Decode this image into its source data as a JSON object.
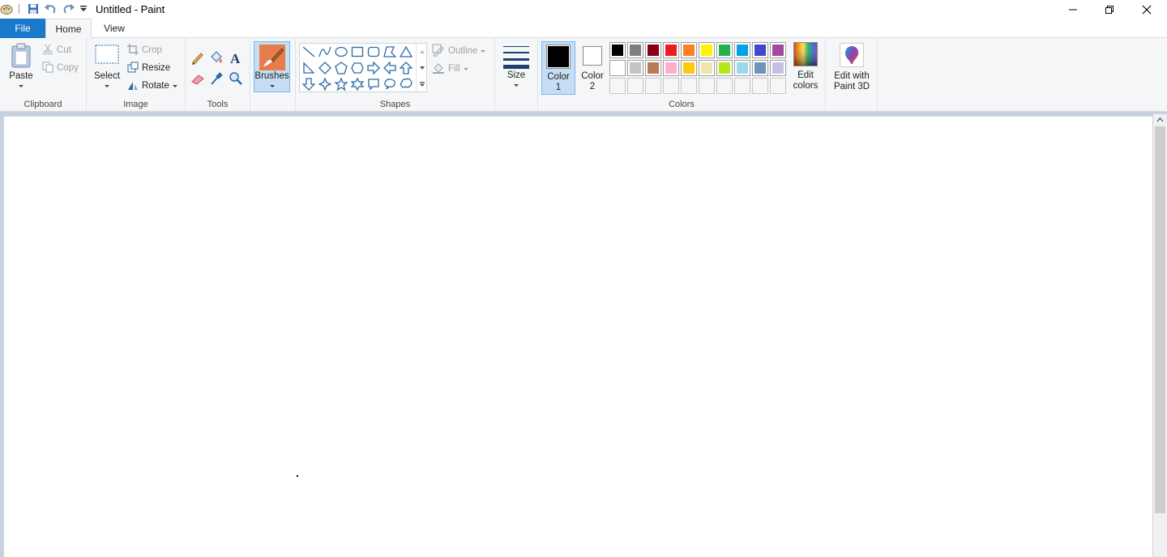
{
  "window": {
    "title": "Untitled - Paint"
  },
  "tabs": [
    {
      "label": "File"
    },
    {
      "label": "Home"
    },
    {
      "label": "View"
    }
  ],
  "help_glyph": "?",
  "clipboard": {
    "paste": "Paste",
    "cut": "Cut",
    "copy": "Copy",
    "group_label": "Clipboard"
  },
  "image": {
    "select": "Select",
    "crop": "Crop",
    "resize": "Resize",
    "rotate": "Rotate",
    "group_label": "Image"
  },
  "tools": {
    "group_label": "Tools"
  },
  "brushes": {
    "label": "Brushes"
  },
  "shapes": {
    "outline": "Outline",
    "fill": "Fill",
    "group_label": "Shapes"
  },
  "size": {
    "label": "Size"
  },
  "colors": {
    "color1_line1": "Color",
    "color1_line2": "1",
    "color2_line1": "Color",
    "color2_line2": "2",
    "edit_line1": "Edit",
    "edit_line2": "colors",
    "group_label": "Colors",
    "color1_value": "#000000",
    "color2_value": "#ffffff",
    "palette_row1": [
      "#000000",
      "#7f7f7f",
      "#880015",
      "#ed1c24",
      "#ff7f27",
      "#fff200",
      "#22b14c",
      "#00a2e8",
      "#3f48cc",
      "#a349a4"
    ],
    "palette_row2": [
      "#ffffff",
      "#c3c3c3",
      "#b97a57",
      "#ffaec9",
      "#ffc90e",
      "#efe4b0",
      "#b5e61d",
      "#99d9ea",
      "#7092be",
      "#c8bfe7"
    ]
  },
  "paint3d": {
    "line1": "Edit with",
    "line2": "Paint 3D"
  },
  "theme": {
    "accent": "#1979ca",
    "ribbon_bg": "#f5f6f7",
    "workspace_bg": "#c7d1e0",
    "active_button": "#c5def5"
  }
}
